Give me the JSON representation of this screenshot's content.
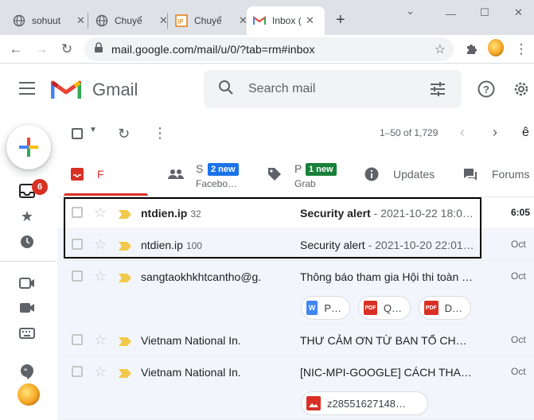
{
  "browser": {
    "tabs": [
      {
        "title": "sohuut",
        "icon": "globe-icon"
      },
      {
        "title": "Chuyể",
        "icon": "globe-icon"
      },
      {
        "title": "Chuyể",
        "icon": "ip-favicon-icon"
      },
      {
        "title": "Inbox (",
        "icon": "gmail-icon"
      }
    ],
    "url": "mail.google.com/mail/u/0/?tab=rm#inbox"
  },
  "gmail": {
    "brand": "Gmail",
    "search_placeholder": "Search mail",
    "inbox_badge": "6",
    "pager": "1–50 of 1,729",
    "categories": {
      "primary": {
        "label": "F"
      },
      "social": {
        "label": "S",
        "pill": "2 new",
        "sub": "Facebo…"
      },
      "promotions": {
        "label": "P",
        "pill": "1 new",
        "sub": "Grab"
      },
      "updates": {
        "label": "Updates"
      },
      "forums": {
        "label": "Forums"
      }
    },
    "messages": [
      {
        "sender": "ntdien.ip",
        "count": "32",
        "subject": "Security alert",
        "snippet": " - 2021-10-22 18:0…",
        "date": "6:05",
        "unread": true
      },
      {
        "sender": "ntdien.ip",
        "count": "100",
        "subject": "Security alert",
        "snippet": " - 2021-10-20 22:01…",
        "date": "Oct",
        "unread": false
      },
      {
        "sender": "sangtaokhkhtcantho@g.",
        "count": "",
        "subject": "Thông báo tham gia Hội thi toàn …",
        "snippet": "",
        "date": "Oct",
        "unread": false,
        "attachments": [
          {
            "type": "W",
            "name": "P…"
          },
          {
            "type": "PDF",
            "name": "Q…"
          },
          {
            "type": "PDF",
            "name": "D…"
          }
        ]
      },
      {
        "sender": "Vietnam National In.",
        "count": "",
        "subject": "THƯ CẢM ƠN TỪ BAN TỔ CHỨC …",
        "snippet": "",
        "date": "Oct",
        "unread": false
      },
      {
        "sender": "Vietnam National In.",
        "count": "",
        "subject": "[NIC-MPI-GOOGLE] CÁCH THAM …",
        "snippet": "",
        "date": "Oct",
        "unread": false,
        "attachments": [
          {
            "type": "IMG",
            "name": "z28551627148…"
          }
        ]
      }
    ]
  },
  "colors": {
    "gmail_red": "#d93025",
    "social_pill": "#1a73e8",
    "promo_pill": "#188038",
    "important": "#f2c94c"
  }
}
